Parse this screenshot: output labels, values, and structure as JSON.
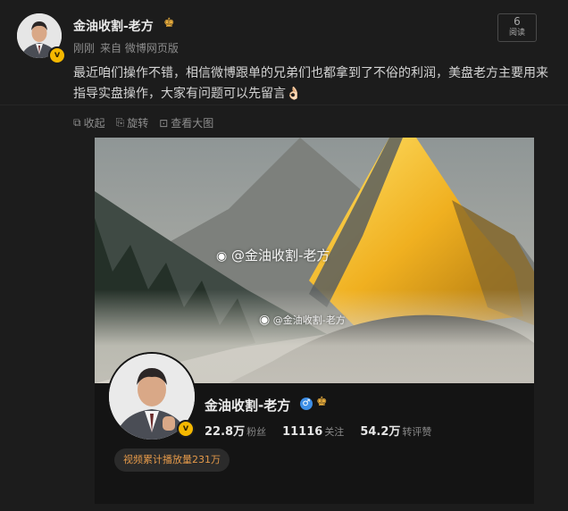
{
  "author": {
    "name": "金油收割-老方",
    "verified_badge": "v",
    "crown_icon": "crown-icon"
  },
  "meta": {
    "time": "刚刚",
    "source": "来自 微博网页版"
  },
  "read": {
    "count": "6",
    "label": "阅读"
  },
  "post": {
    "text": "最近咱们操作不错，相信微博跟单的兄弟们也都拿到了不俗的利润，美盘老方主要用来指导实盘操作，大家有问题可以先留言👌🏻"
  },
  "toolbar": {
    "collapse": "收起",
    "rotate": "旋转",
    "view_large": "查看大图"
  },
  "watermark": {
    "large": "@金油收割-老方",
    "small": "@金油收割-老方"
  },
  "card": {
    "name": "金油收割-老方",
    "gender_symbol": "♂",
    "stats": [
      {
        "value": "22.8万",
        "label": "粉丝"
      },
      {
        "value": "11116",
        "label": "关注"
      },
      {
        "value": "54.2万",
        "label": "转评赞"
      }
    ],
    "play_count": "视频累计播放量231万"
  },
  "colors": {
    "background": "#1c1c1c",
    "verified": "#f5b800",
    "accent": "#e59a4a",
    "gender": "#3d8ee6"
  }
}
